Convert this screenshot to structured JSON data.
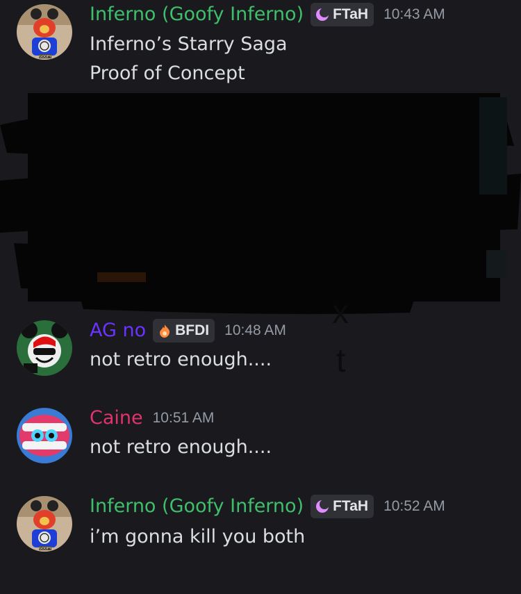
{
  "messages": [
    {
      "username": "Inferno (Goofy Inferno)",
      "username_color": "#3fbf6c",
      "tag": "FTaH",
      "tag_icon": "crescent-moon-icon",
      "tag_icon_color": "#e08cff",
      "time": "10:43 AM",
      "avatar_badge": "GOOFY",
      "lines": [
        "Inferno’s Starry Saga",
        "Proof of Concept"
      ]
    },
    {
      "username": "AG no",
      "username_color": "#6a33ff",
      "tag": "BFDI",
      "tag_icon": "flame-icon",
      "tag_icon_color": "#ff8a3d",
      "time": "10:48 AM",
      "lines": [
        "not retro enough...."
      ]
    },
    {
      "username": "Caine",
      "username_color": "#e2336c",
      "time": "10:51 AM",
      "lines": [
        "not retro enough...."
      ]
    },
    {
      "username": "Inferno (Goofy Inferno)",
      "username_color": "#3fbf6c",
      "tag": "FTaH",
      "tag_icon": "crescent-moon-icon",
      "tag_icon_color": "#e08cff",
      "time": "10:52 AM",
      "avatar_badge": "GOOFY",
      "lines": [
        "i’m gonna kill you both"
      ]
    }
  ],
  "stray_letters": [
    "x",
    "t"
  ]
}
